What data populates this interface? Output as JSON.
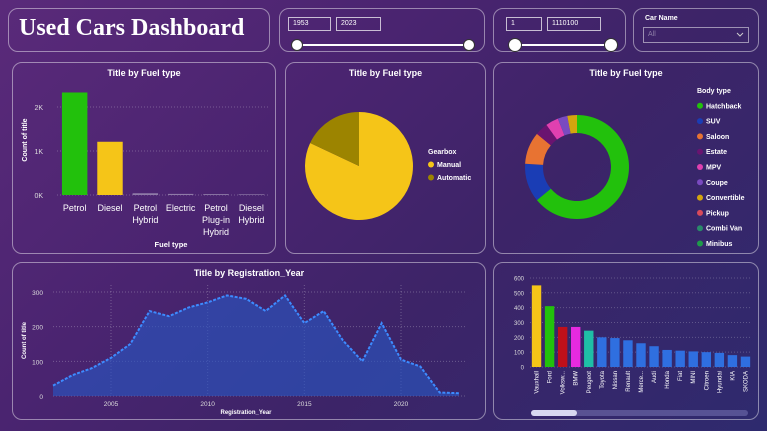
{
  "title": "Used Cars Dashboard",
  "year_filter": {
    "min": "1953",
    "max": "2023",
    "range": [
      0,
      1
    ]
  },
  "mileage_filter": {
    "min": "1",
    "max": "1110100",
    "range": [
      0,
      1
    ]
  },
  "car_name_filter": {
    "label": "Car Name",
    "value": "All"
  },
  "colors": {
    "green": "#22c10c",
    "yellow": "#f5c518",
    "olive": "#9c8400",
    "blue": "#2f6fe0",
    "area": "#2a55c0"
  },
  "chart_data": [
    {
      "type": "bar",
      "title": "Title by Fuel type",
      "xlabel": "Fuel type",
      "ylabel": "Count of title",
      "categories": [
        "Petrol",
        "Diesel",
        "Petrol Hybrid",
        "Electric",
        "Petrol Plug-in Hybrid",
        "Diesel Hybrid"
      ],
      "category_lines": [
        [
          "Petrol"
        ],
        [
          "Diesel"
        ],
        [
          "Petrol",
          "Hybrid"
        ],
        [
          "Electric"
        ],
        [
          "Petrol",
          "Plug-in",
          "Hybrid"
        ],
        [
          "Diesel",
          "Hybrid"
        ]
      ],
      "values": [
        2330,
        1210,
        40,
        25,
        20,
        15
      ],
      "bar_colors": [
        "#22c10c",
        "#f5c518",
        "#8f7aa8",
        "#8f7aa8",
        "#8f7aa8",
        "#8f7aa8"
      ],
      "yticks": [
        0,
        1000,
        2000
      ],
      "ytick_labels": [
        "0K",
        "1K",
        "2K"
      ],
      "ylim": [
        0,
        2500
      ]
    },
    {
      "type": "pie",
      "title": "Title by Fuel type",
      "legend_title": "Gearbox",
      "labels": [
        "Manual",
        "Automatic"
      ],
      "values": [
        82,
        18
      ],
      "colors": [
        "#f5c518",
        "#9c8400"
      ]
    },
    {
      "type": "pie",
      "title": "Title by Fuel type",
      "legend_title": "Body type",
      "labels": [
        "Hatchback",
        "SUV",
        "Saloon",
        "Estate",
        "MPV",
        "Coupe",
        "Convertible",
        "Pickup",
        "Combi Van",
        "Minibus"
      ],
      "values": [
        64,
        12,
        10,
        4,
        4,
        3,
        3,
        0,
        0,
        0
      ],
      "colors": [
        "#22c10c",
        "#1a3db5",
        "#e87332",
        "#6a1470",
        "#e040b0",
        "#7a4ac0",
        "#d4a50e",
        "#d94a5a",
        "#2a8a6a",
        "#1f9a4a"
      ]
    },
    {
      "type": "area",
      "title": "Title by Registration_Year",
      "xlabel": "Registration_Year",
      "ylabel": "Count of title",
      "x": [
        2002,
        2003,
        2004,
        2005,
        2006,
        2007,
        2008,
        2009,
        2010,
        2011,
        2012,
        2013,
        2014,
        2015,
        2016,
        2017,
        2018,
        2019,
        2020,
        2021,
        2022,
        2023
      ],
      "y": [
        30,
        60,
        80,
        110,
        150,
        245,
        230,
        255,
        270,
        290,
        280,
        245,
        290,
        210,
        245,
        160,
        100,
        210,
        105,
        85,
        10,
        8
      ],
      "xticks": [
        2005,
        2010,
        2015,
        2020
      ],
      "yticks": [
        0,
        100,
        200,
        300
      ],
      "xlim": [
        2002,
        2023
      ],
      "ylim": [
        0,
        320
      ]
    },
    {
      "type": "bar",
      "categories": [
        "Vauxhall",
        "Ford",
        "Volksw...",
        "BMW",
        "Peugeot",
        "Toyota",
        "Nissan",
        "Renault",
        "Merce...",
        "Audi",
        "Honda",
        "Fiat",
        "MINI",
        "Citroen",
        "Hyundai",
        "KIA",
        "SKODA"
      ],
      "values": [
        550,
        410,
        270,
        270,
        245,
        200,
        195,
        180,
        160,
        140,
        115,
        110,
        105,
        100,
        95,
        80,
        70
      ],
      "bar_colors": [
        "#f5c518",
        "#22c10c",
        "#c0101a",
        "#e62ae0",
        "#1fbfa6",
        "#2f6fe0",
        "#2f6fe0",
        "#2f6fe0",
        "#2f6fe0",
        "#2f6fe0",
        "#2f6fe0",
        "#2f6fe0",
        "#2f6fe0",
        "#2f6fe0",
        "#2f6fe0",
        "#2f6fe0",
        "#2f6fe0"
      ],
      "yticks": [
        0,
        100,
        200,
        300,
        400,
        500,
        600
      ],
      "ylim": [
        0,
        620
      ]
    }
  ]
}
